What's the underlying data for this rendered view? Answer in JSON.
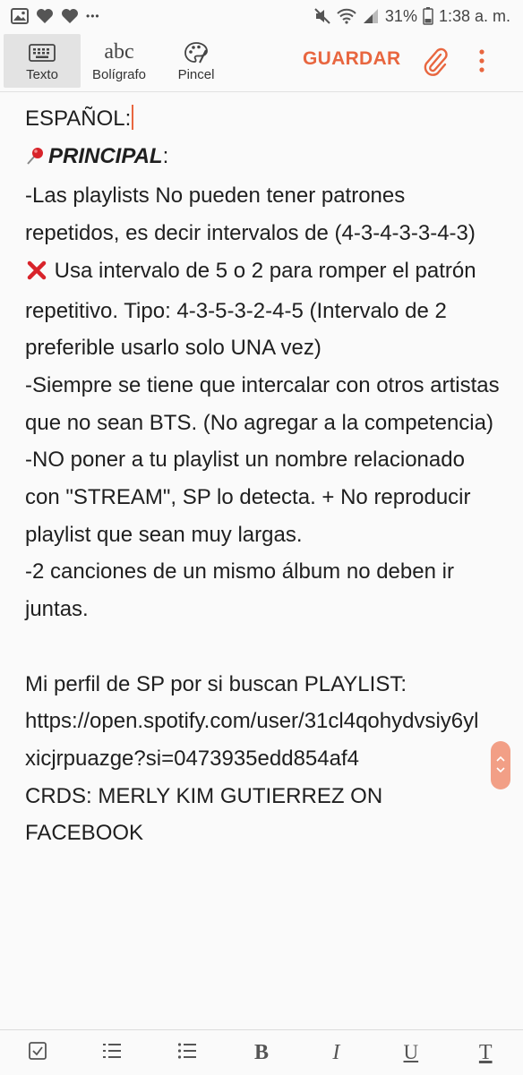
{
  "status_bar": {
    "battery_percent": "31%",
    "time": "1:38 a. m.",
    "overflow_dots": "•••"
  },
  "toolbar": {
    "tools": [
      {
        "label": "Texto",
        "icon": "keyboard-icon"
      },
      {
        "label": "Bolígrafo",
        "icon_text": "abc"
      },
      {
        "label": "Pincel",
        "icon": "palette-icon"
      }
    ],
    "save_label": "GUARDAR"
  },
  "note": {
    "heading": "ESPAÑOL:",
    "principal_label": "PRINCIPAL",
    "principal_colon": ":",
    "line1": "-Las playlists No pueden tener patrones repetidos, es decir intervalos de (4-3-4-3-3-4-3)",
    "line1b": " Usa intervalo de 5 o 2 para romper el patrón repetitivo. Tipo: 4-3-5-3-2-4-5 (Intervalo de 2 preferible usarlo solo UNA vez)",
    "line2": "-Siempre se tiene que intercalar con otros artistas que no sean BTS. (No agregar a la competencia)",
    "line3": "-NO poner a tu playlist un nombre relacionado con \"STREAM\", SP lo detecta. + No reproducir playlist que sean muy largas.",
    "line4": "-2 canciones de un mismo álbum no deben ir juntas.",
    "profile_line": "Mi perfil de SP por si buscan PLAYLIST:",
    "profile_url": "https://open.spotify.com/user/31cl4qohydvsiy6ylxicjrpuazge?si=0473935edd854af4",
    "credits": "CRDS: MERLY KIM GUTIERREZ ON FACEBOOK"
  },
  "format_bar": {
    "bold": "B",
    "italic": "I",
    "underline": "U",
    "text_color": "T"
  },
  "colors": {
    "accent": "#e8663f",
    "scroll_handle": "#f29f86",
    "cross_mark": "#d8232a"
  }
}
